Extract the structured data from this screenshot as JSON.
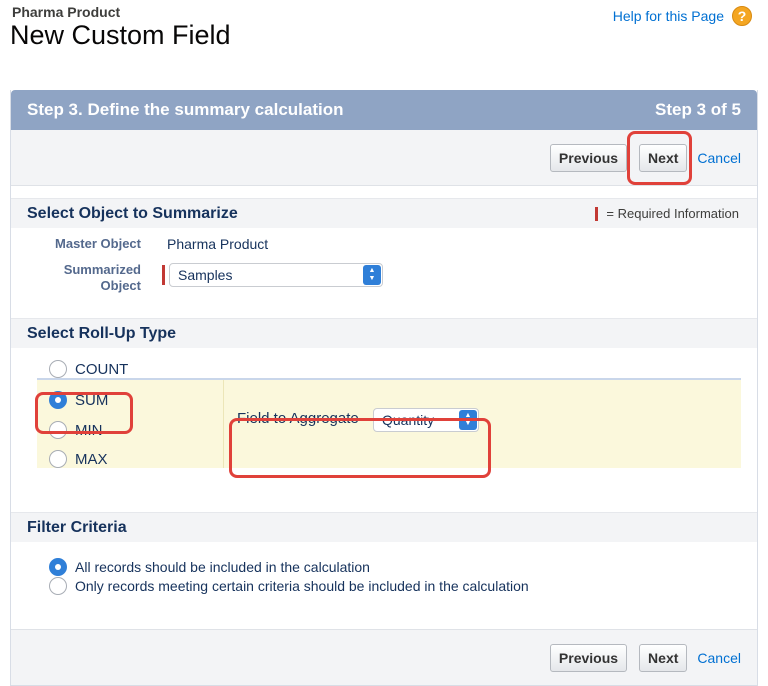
{
  "header": {
    "breadcrumb": "Pharma Product",
    "title": "New Custom Field",
    "help_label": "Help for this Page",
    "help_icon": "help-icon"
  },
  "step": {
    "title": "Step 3. Define the summary calculation",
    "indicator": "Step 3 of 5"
  },
  "buttons": {
    "previous": "Previous",
    "next": "Next",
    "cancel": "Cancel"
  },
  "section_object": {
    "title": "Select Object to Summarize",
    "required_legend": "= Required Information",
    "master_label": "Master Object",
    "master_value": "Pharma Product",
    "summarized_label_1": "Summarized",
    "summarized_label_2": "Object",
    "summarized_value": "Samples"
  },
  "section_rollup": {
    "title": "Select Roll-Up Type",
    "options": [
      "COUNT",
      "SUM",
      "MIN",
      "MAX"
    ],
    "selected": "SUM",
    "aggregate_label": "Field to Aggregate",
    "aggregate_value": "Quantity"
  },
  "section_filter": {
    "title": "Filter Criteria",
    "options": [
      "All records should be included in the calculation",
      "Only records meeting certain criteria should be included in the calculation"
    ],
    "selected_index": 0
  },
  "colors": {
    "header_bg": "#8fa4c4",
    "link": "#0070d2",
    "highlight": "#e0413a",
    "sum_panel_bg": "#fbf8dc",
    "radio_selected": "#2f7fd8"
  }
}
